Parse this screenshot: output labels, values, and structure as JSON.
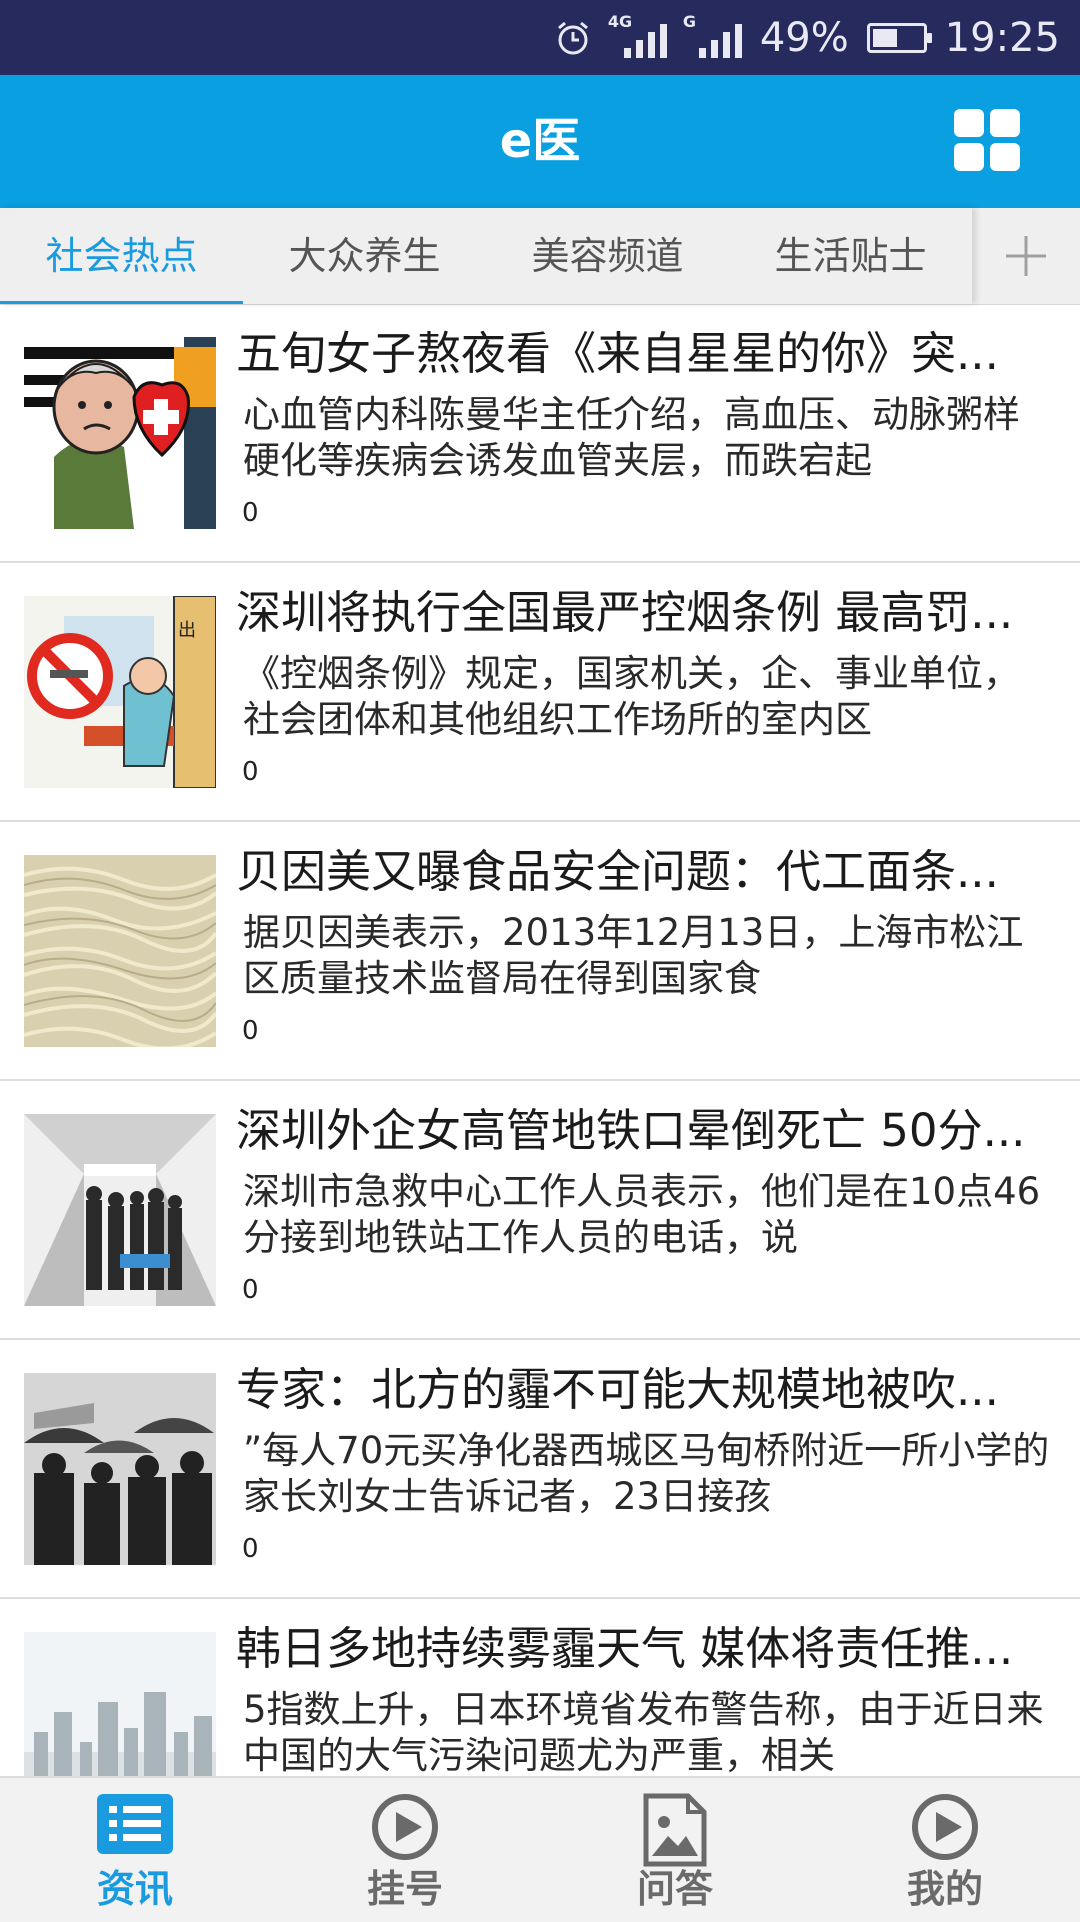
{
  "status_bar": {
    "network_1": "4G",
    "network_2": "G",
    "battery_percent": "49%",
    "battery_level": 0.49,
    "time": "19:25"
  },
  "header": {
    "title": "e医",
    "grid_icon": "grid-icon"
  },
  "tabs": [
    {
      "label": "社会热点",
      "active": true
    },
    {
      "label": "大众养生",
      "active": false
    },
    {
      "label": "美容频道",
      "active": false
    },
    {
      "label": "生活贴士",
      "active": false
    }
  ],
  "tab_add_icon": "plus-icon",
  "articles": [
    {
      "title": "五旬女子熬夜看《来自星星的你》突...",
      "desc": "心血管内科陈曼华主任介绍，高血压、动脉粥样硬化等疾病会诱发血管夹层，而跌宕起",
      "count": "0",
      "thumb": "cartoon-heart"
    },
    {
      "title": "深圳将执行全国最严控烟条例 最高罚...",
      "desc": "《控烟条例》规定，国家机关，企、事业单位，社会团体和其他组织工作场所的室内区",
      "count": "0",
      "thumb": "no-smoking"
    },
    {
      "title": "贝因美又曝食品安全问题：代工面条...",
      "desc": "据贝因美表示，2013年12月13日，上海市松江区质量技术监督局在得到国家食",
      "count": "0",
      "thumb": "noodles"
    },
    {
      "title": "深圳外企女高管地铁口晕倒死亡 50分...",
      "desc": "深圳市急救中心工作人员表示，他们是在10点46分接到地铁站工作人员的电话，说",
      "count": "0",
      "thumb": "subway-people"
    },
    {
      "title": "专家：北方的霾不可能大规模地被吹...",
      "desc": "”每人70元买净化器西城区马甸桥附近一所小学的家长刘女士告诉记者，23日接孩",
      "count": "0",
      "thumb": "umbrellas"
    },
    {
      "title": "韩日多地持续雾霾天气 媒体将责任推...",
      "desc": "5指数上升，日本环境省发布警告称，由于近日来中国的大气污染问题尤为严重，相关",
      "count": "",
      "thumb": "city-smog"
    }
  ],
  "bottom_nav": [
    {
      "label": "资讯",
      "icon": "list-icon",
      "active": true
    },
    {
      "label": "挂号",
      "icon": "play-circle-icon",
      "active": false
    },
    {
      "label": "问答",
      "icon": "image-file-icon",
      "active": false
    },
    {
      "label": "我的",
      "icon": "play-circle-icon",
      "active": false
    }
  ],
  "colors": {
    "status_bar": "#262a5d",
    "header": "#0a9fe0",
    "accent": "#1a9be0"
  }
}
